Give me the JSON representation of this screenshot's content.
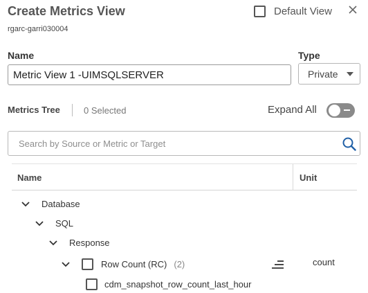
{
  "header": {
    "title": "Create Metrics View",
    "subtitle": "rgarc-garri030004",
    "default_view_label": "Default View"
  },
  "form": {
    "name_label": "Name",
    "name_value": "Metric View 1 -UIMSQLSERVER",
    "type_label": "Type",
    "type_value": "Private"
  },
  "tree_bar": {
    "title": "Metrics Tree",
    "selected": "0 Selected",
    "expand_all_label": "Expand All",
    "expand_all_on": false
  },
  "search": {
    "placeholder": "Search by Source or Metric or Target"
  },
  "table": {
    "columns": [
      "Name",
      "Unit"
    ],
    "rows": [
      {
        "label": "Database",
        "level": 0,
        "expanded": true
      },
      {
        "label": "SQL",
        "level": 1,
        "expanded": true
      },
      {
        "label": "Response",
        "level": 2,
        "expanded": true
      },
      {
        "label": "Row Count (RC)",
        "count": "(2)",
        "unit": "count",
        "level": 3,
        "expanded": true,
        "checkbox": true
      },
      {
        "label": "cdm_snapshot_row_count_last_hour",
        "level": 4,
        "checkbox": true
      }
    ]
  },
  "icons": {
    "close": "close-icon",
    "search": "search-icon",
    "sort": "sort-lines-icon",
    "chevron": "chevron-down-icon"
  },
  "colors": {
    "search_icon": "#1f5fa6",
    "toggle_off": "#8a8a8a"
  }
}
